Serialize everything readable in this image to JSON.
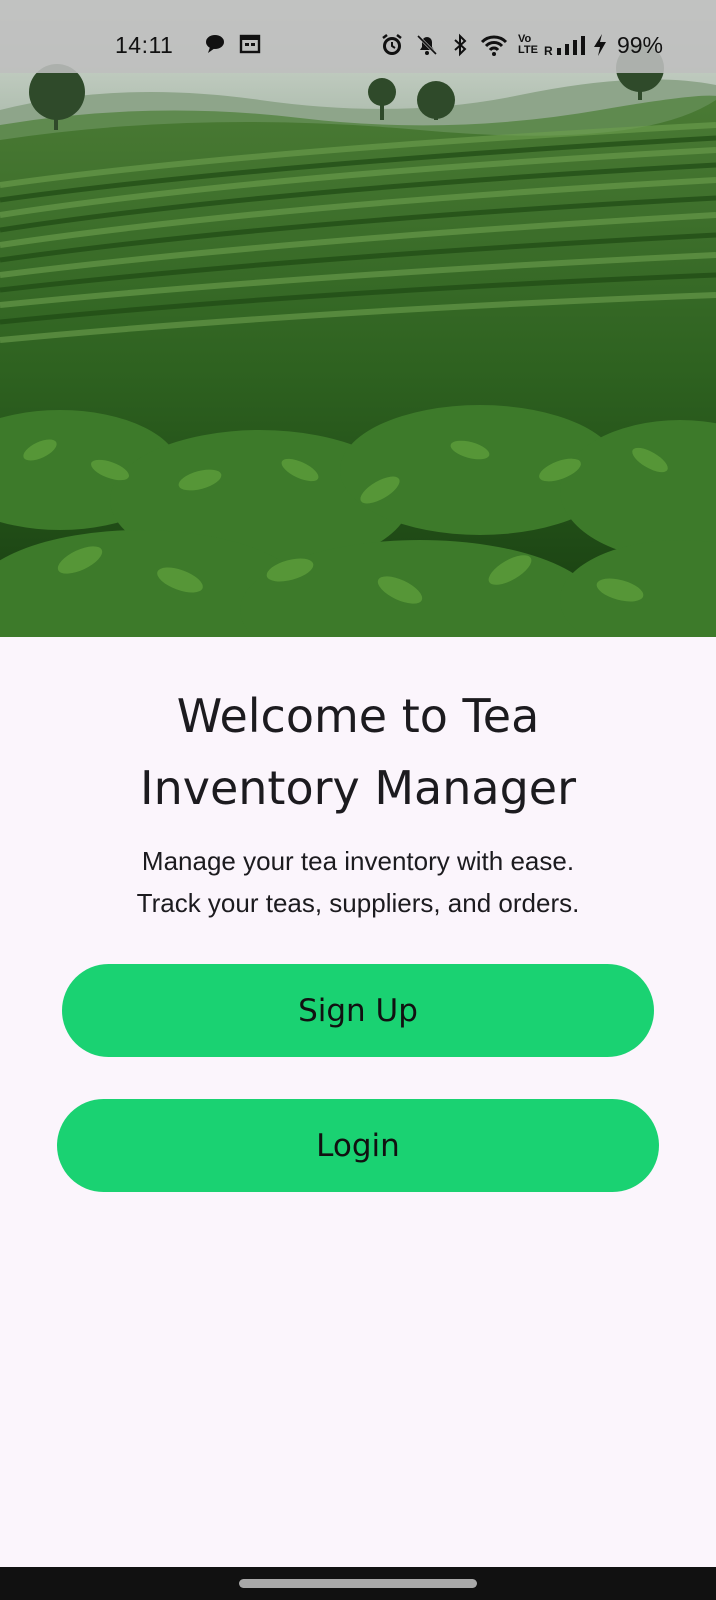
{
  "status_bar": {
    "time": "14:11",
    "battery": "99%",
    "icons": [
      "chat-bubble-icon",
      "calendar-icon",
      "alarm-icon",
      "mute-bell-icon",
      "bluetooth-icon",
      "wifi-icon",
      "volte-icon",
      "signal-icon",
      "charging-bolt-icon"
    ],
    "volte_label": "Vo LTE",
    "roaming_label": "R"
  },
  "hero": {
    "description_icon": "tea-plantation-image"
  },
  "welcome": {
    "title_line1": "Welcome to Tea",
    "title_line2": "Inventory Manager",
    "subtitle_line1": "Manage your tea inventory with ease.",
    "subtitle_line2": "Track your teas, suppliers, and orders."
  },
  "buttons": {
    "signup_label": "Sign Up",
    "login_label": "Login"
  },
  "colors": {
    "accent": "#1ad272",
    "background": "#fbf5fc",
    "text": "#1c1b1f"
  }
}
